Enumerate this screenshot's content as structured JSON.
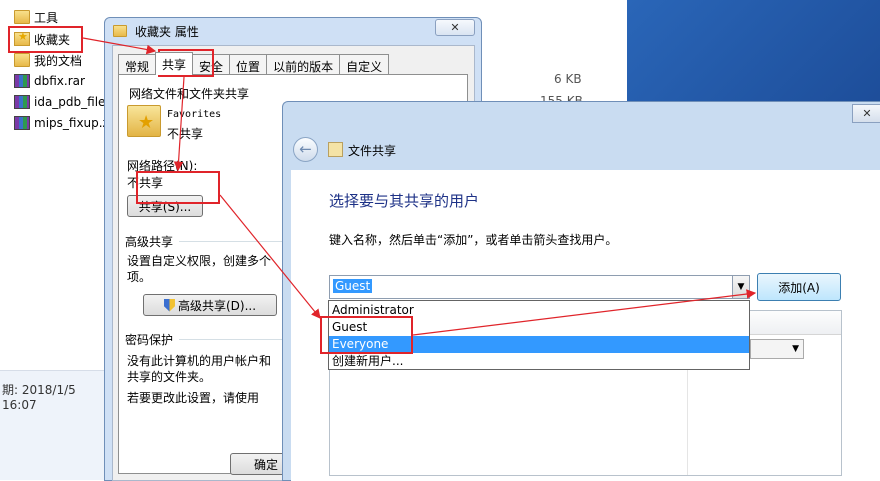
{
  "explorer": {
    "files": [
      {
        "name": "工具",
        "icon": "folder-icon"
      },
      {
        "name": "收藏夹",
        "icon": "favorites-folder-icon"
      },
      {
        "name": "我的文档",
        "icon": "folder-icon"
      },
      {
        "name": "dbfix.rar",
        "icon": "rar-archive-icon"
      },
      {
        "name": "ida_pdb_file",
        "icon": "rar-archive-icon"
      },
      {
        "name": "mips_fixup.z",
        "icon": "rar-archive-icon"
      }
    ],
    "sizes": [
      "6 KB",
      "155 KB"
    ],
    "status_date": "期: 2018/1/5 16:07"
  },
  "properties": {
    "title": "收藏夹 属性",
    "tabs": [
      "常规",
      "共享",
      "安全",
      "位置",
      "以前的版本",
      "自定义"
    ],
    "active_tab": "共享",
    "network_group_title": "网络文件和文件夹共享",
    "folder_name": "Favorites",
    "share_status": "不共享",
    "network_path_label": "网络路径(N):",
    "network_path_value": "不共享",
    "share_button": "共享(S)...",
    "advanced_group_title": "高级共享",
    "advanced_desc_line1": "设置自定义权限，创建多个",
    "advanced_desc_line2": "项。",
    "advanced_button": "高级共享(D)...",
    "password_group_title": "密码保护",
    "password_desc_line1": "没有此计算机的用户帐户和",
    "password_desc_line2": "共享的文件夹。",
    "password_change_text": "若要更改此设置，请使用",
    "ok_button": "确定"
  },
  "sharing": {
    "window_title": "文件共享",
    "heading": "选择要与其共享的用户",
    "instruction": "键入名称，然后单击“添加”，或者单击箭头查找用户。",
    "input_value": "Guest",
    "add_button": "添加(A)",
    "dropdown_options": [
      "Administrator",
      "Guest",
      "Everyone",
      "创建新用户..."
    ],
    "highlighted_option": "Everyone"
  },
  "colors": {
    "annotation_red": "#e0242a",
    "selection_blue": "#3399ff",
    "heading_blue": "#1e3287"
  }
}
